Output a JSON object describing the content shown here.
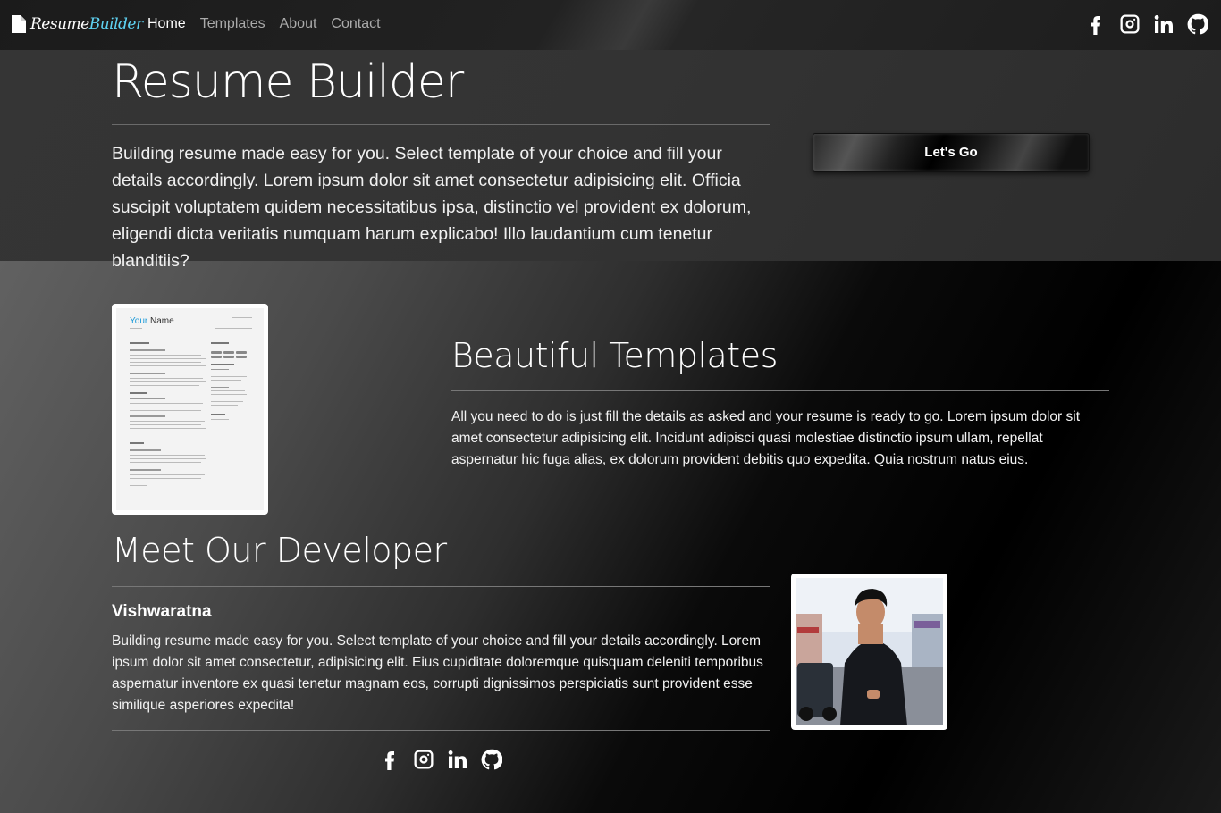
{
  "brand": {
    "part1": "Resume",
    "part2": "Builder",
    "accent_color": "#5fd3f3",
    "icon": "document-icon"
  },
  "nav": {
    "links": [
      {
        "label": "Home",
        "active": true
      },
      {
        "label": "Templates",
        "active": false
      },
      {
        "label": "About",
        "active": false
      },
      {
        "label": "Contact",
        "active": false
      }
    ],
    "social": [
      "facebook-icon",
      "instagram-icon",
      "linkedin-icon",
      "github-icon"
    ]
  },
  "hero": {
    "title": "Resume Builder",
    "text": "Building resume made easy for you. Select template of your choice and fill your details accordingly. Lorem ipsum dolor sit amet consectetur adipisicing elit. Officia suscipit voluptatem quidem necessitatibus ipsa, distinctio vel provident ex dolorum, eligendi dicta veritatis numquam harum explicabo! Illo laudantium cum tenetur blanditiis?",
    "button_label": "Let's Go"
  },
  "templates": {
    "preview_name_first": "Your",
    "preview_name_second": "Name",
    "title": "Beautiful Templates",
    "text": "All you need to do is just fill the details as asked and your resume is ready to go. Lorem ipsum dolor sit amet consectetur adipisicing elit. Incidunt adipisci quasi molestiae distinctio ipsum ullam, repellat aspernatur hic fuga alias, ex dolorum provident debitis quo expedita. Quia nostrum natus eius."
  },
  "developer": {
    "title": "Meet Our Developer",
    "name": "Vishwaratna",
    "text": "Building resume made easy for you. Select template of your choice and fill your details accordingly. Lorem ipsum dolor sit amet consectetur, adipisicing elit. Eius cupiditate doloremque quisquam deleniti temporibus aspernatur inventore ex quasi tenetur magnam eos, corrupti dignissimos perspiciatis sunt provident esse similique asperiores expedita!",
    "social": [
      "facebook-icon",
      "instagram-icon",
      "linkedin-icon",
      "github-icon"
    ]
  }
}
